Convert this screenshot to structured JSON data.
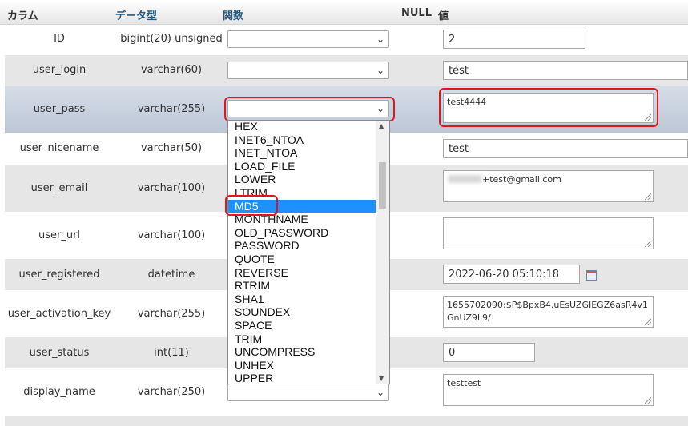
{
  "headers": {
    "column": "カラム",
    "type": "データ型",
    "function": "関数",
    "null": "NULL",
    "value": "値"
  },
  "rows": [
    {
      "name": "ID",
      "type": "bigint(20) unsigned",
      "value": "2"
    },
    {
      "name": "user_login",
      "type": "varchar(60)",
      "value": "test"
    },
    {
      "name": "user_pass",
      "type": "varchar(255)",
      "value": "test4444"
    },
    {
      "name": "user_nicename",
      "type": "varchar(50)",
      "value": "test"
    },
    {
      "name": "user_email",
      "type": "varchar(100)",
      "value": "+test@gmail.com"
    },
    {
      "name": "user_url",
      "type": "varchar(100)",
      "value": ""
    },
    {
      "name": "user_registered",
      "type": "datetime",
      "value": "2022-06-20 05:10:18"
    },
    {
      "name": "user_activation_key",
      "type": "varchar(255)",
      "value": "1655702090:$P$BpxB4.uEsUZGIEGZ6asR4v1GnUZ9L9/"
    },
    {
      "name": "user_status",
      "type": "int(11)",
      "value": "0"
    },
    {
      "name": "display_name",
      "type": "varchar(250)",
      "value": "testtest"
    }
  ],
  "function_options": [
    "HEX",
    "INET6_NTOA",
    "INET_NTOA",
    "LOAD_FILE",
    "LOWER",
    "LTRIM",
    "MD5",
    "MONTHNAME",
    "OLD_PASSWORD",
    "PASSWORD",
    "QUOTE",
    "REVERSE",
    "RTRIM",
    "SHA1",
    "SOUNDEX",
    "SPACE",
    "TRIM",
    "UNCOMPRESS",
    "UNHEX",
    "UPPER"
  ],
  "highlighted_option": "MD5",
  "icons": {
    "select_chevron": "chevron-down-icon",
    "calendar": "calendar-icon",
    "scroll_up": "scroll-up-icon",
    "scroll_down": "scroll-down-icon"
  },
  "colors": {
    "annotation": "#e0161e",
    "selected_option": "#1e90ff",
    "highlight_row": "#c7d0dd"
  }
}
